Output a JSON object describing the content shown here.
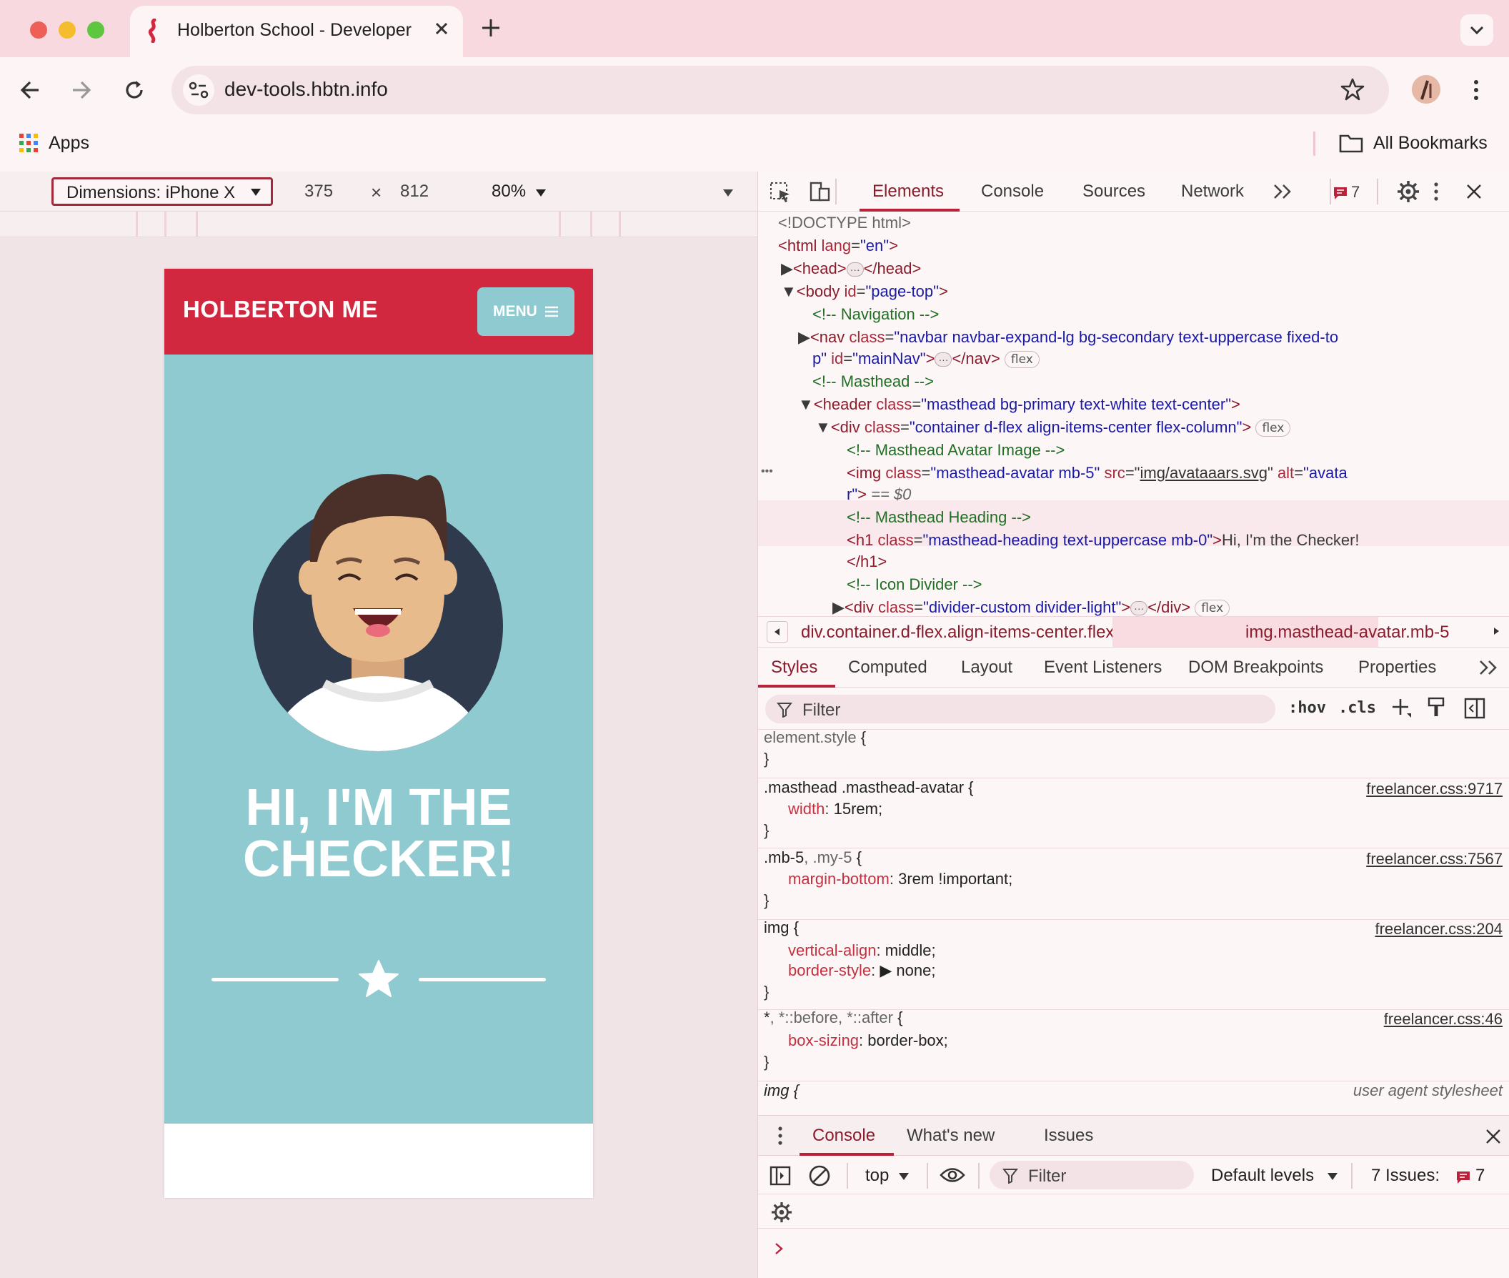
{
  "browser": {
    "tab_title": "Holberton School - Developer tools",
    "url": "dev-tools.hbtn.info",
    "bookmarks": {
      "apps": "Apps",
      "all": "All Bookmarks"
    }
  },
  "device_toolbar": {
    "device": "Dimensions: iPhone X",
    "width": "375",
    "times": "×",
    "height": "812",
    "zoom": "80%"
  },
  "site": {
    "brand": "HOLBERTON ME",
    "menu": "MENU",
    "heading_line1": "HI, I'M THE",
    "heading_line2": "CHECKER!",
    "colors": {
      "navbar": "#d2283f",
      "masthead": "#8ecad0",
      "button": "#8ecad0",
      "avatar_bg": "#2f3a4d"
    }
  },
  "devtools": {
    "tabs": [
      "Elements",
      "Console",
      "Sources",
      "Network"
    ],
    "issues_count": "7",
    "dom": {
      "doctype": "<!DOCTYPE html>",
      "html_open": "<html",
      "html_attr": "lang",
      "html_val": "\"en\"",
      "head_open": "<head>",
      "head_close": "</head>",
      "body_open": "<body",
      "body_attr": "id",
      "body_val": "\"page-top\"",
      "comment_nav": "<!-- Navigation -->",
      "nav_open": "<nav",
      "nav_attr": "class",
      "nav_val_1": "\"navbar navbar-expand-lg bg-secondary text-uppercase fixed-to",
      "nav_val_2": "p\"",
      "nav_id_attr": "id",
      "nav_id_val": "\"mainNav\"",
      "nav_close": "</nav>",
      "comment_masthead": "<!-- Masthead -->",
      "header_open": "<header",
      "header_attr": "class",
      "header_val": "\"masthead bg-primary text-white text-center\"",
      "div_open": "<div",
      "div_attr": "class",
      "div_val": "\"container d-flex align-items-center flex-column\"",
      "comment_avatar": "<!-- Masthead Avatar Image -->",
      "img_open": "<img",
      "img_class_attr": "class",
      "img_class_val": "\"masthead-avatar mb-5\"",
      "img_src_attr": "src",
      "img_src_val": "img/avataaars.svg",
      "img_alt_attr": "alt",
      "img_alt_val_1": "\"avata",
      "img_alt_val_2": "r\"",
      "selected_marker": "== $0",
      "comment_heading": "<!-- Masthead Heading -->",
      "h1_open": "<h1",
      "h1_attr": "class",
      "h1_val": "\"masthead-heading text-uppercase mb-0\"",
      "h1_text": "Hi, I'm the Checker!",
      "h1_close": "</h1>",
      "comment_divider": "<!-- Icon Divider -->",
      "div2_attr": "class",
      "div2_val": "\"divider-custom divider-light\"",
      "div_close": "</div>",
      "flex": "flex"
    },
    "breadcrumbs": [
      "div.container.d-flex.align-items-center.flex-column",
      "img.masthead-avatar.mb-5"
    ],
    "style_tabs": [
      "Styles",
      "Computed",
      "Layout",
      "Event Listeners",
      "DOM Breakpoints",
      "Properties"
    ],
    "filter_placeholder": "Filter",
    "hov": ":hov",
    "cls": ".cls",
    "rules": [
      {
        "selector": "element.style",
        "source": ""
      },
      {
        "selector": ".masthead .masthead-avatar",
        "source": "freelancer.css:9717",
        "prop": "width",
        "value": "15rem;"
      },
      {
        "selector": ".mb-5",
        "selector_dim": ", .my-5",
        "source": "freelancer.css:7567",
        "prop": "margin-bottom",
        "value": "3rem !important;"
      },
      {
        "selector": "img",
        "source": "freelancer.css:204",
        "prop": "vertical-align",
        "value": "middle;",
        "prop2": "border-style",
        "value2": "none;"
      },
      {
        "selector": "*",
        "selector_dim": ", *::before, *::after",
        "source": "freelancer.css:46",
        "prop": "box-sizing",
        "value": "border-box;"
      },
      {
        "selector": "img",
        "source": "user agent stylesheet"
      }
    ],
    "drawer_tabs": [
      "Console",
      "What's new",
      "Issues"
    ],
    "console": {
      "context": "top",
      "filter": "Filter",
      "levels": "Default levels",
      "issues": "7 Issues:",
      "issues_count": "7"
    }
  }
}
